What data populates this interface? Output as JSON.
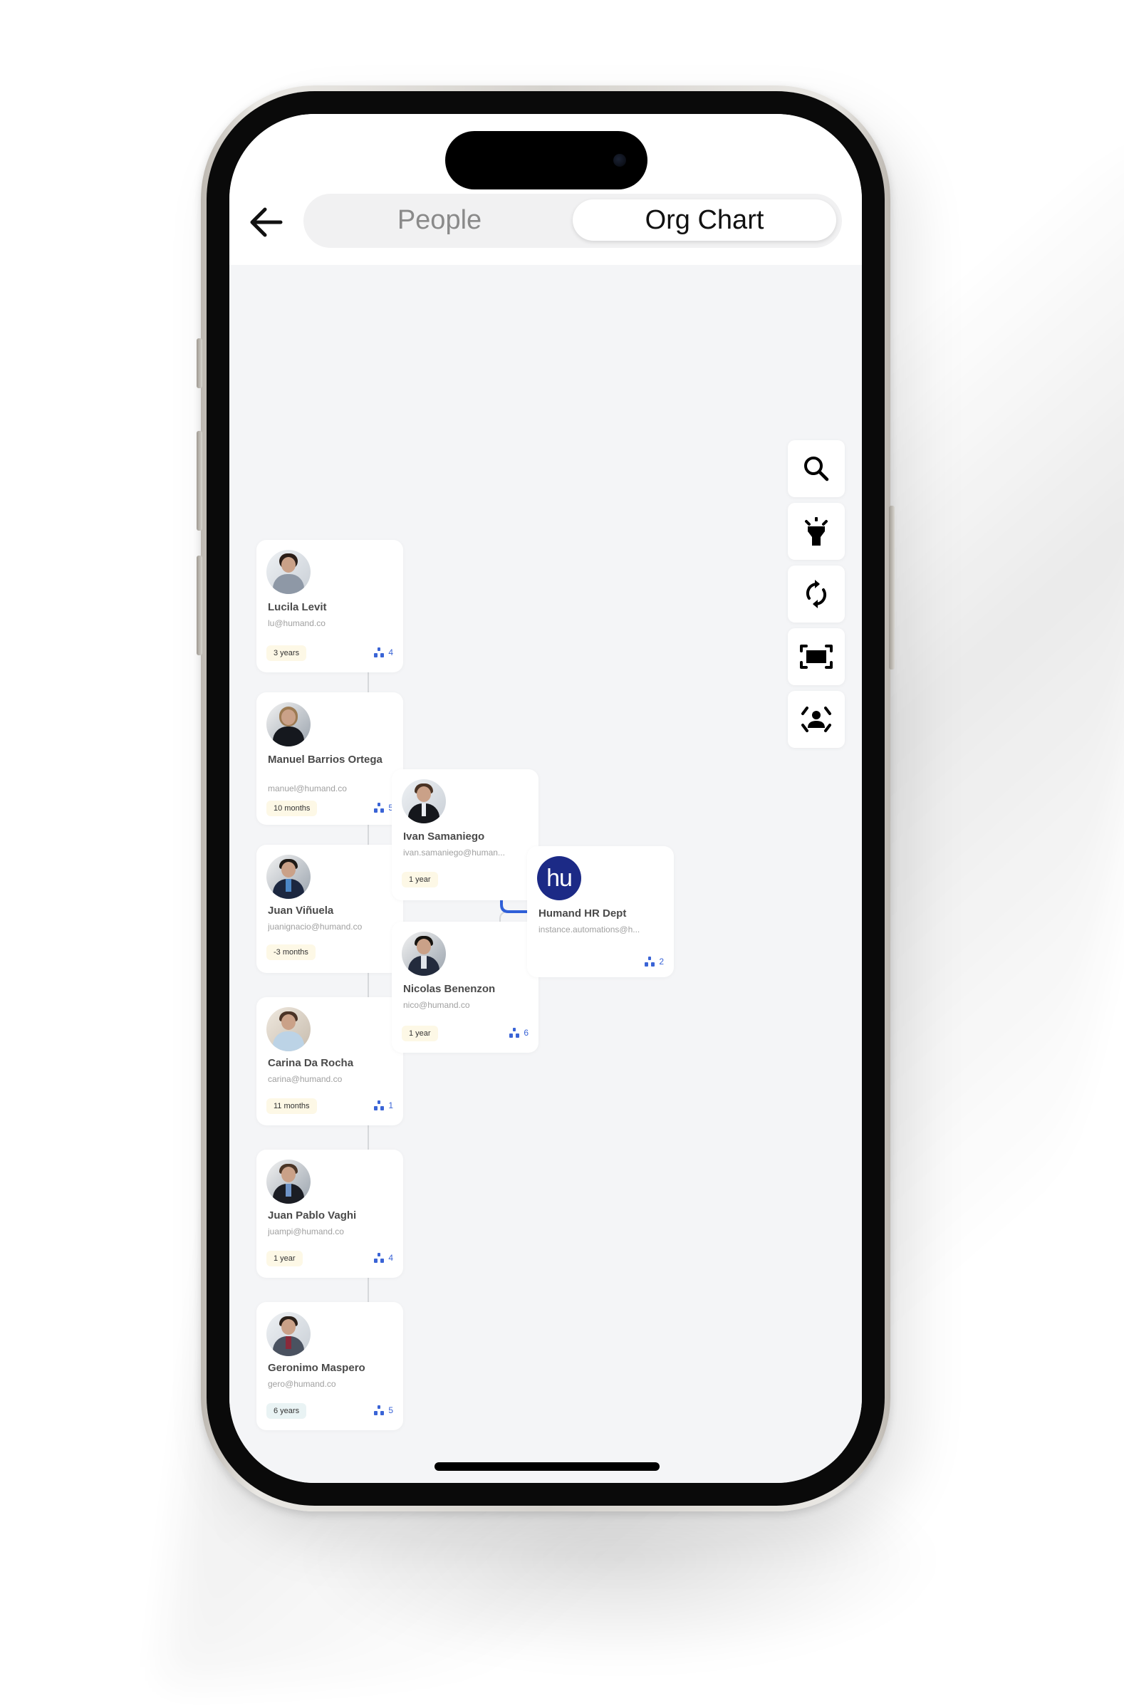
{
  "header": {
    "back_label": "Back",
    "tabs": [
      {
        "label": "People",
        "active": false
      },
      {
        "label": "Org Chart",
        "active": true
      }
    ]
  },
  "toolbar": {
    "buttons": [
      {
        "icon": "search-icon",
        "label": "Search"
      },
      {
        "icon": "flashlight-icon",
        "label": "Highlight"
      },
      {
        "icon": "refresh-icon",
        "label": "Reset"
      },
      {
        "icon": "fit-screen-icon",
        "label": "Fit to screen"
      },
      {
        "icon": "center-user-icon",
        "label": "Center on me"
      }
    ]
  },
  "org_chart": {
    "root": {
      "name": "Humand HR Dept",
      "email": "instance.automations@h...",
      "logo_text": "hu",
      "reports": "2",
      "logo_color": "#1c2a86"
    },
    "managers": [
      {
        "name": "Ivan Samaniego",
        "email": "ivan.samaniego@human...",
        "tenure": "1 year",
        "reports": null
      },
      {
        "name": "Nicolas Benenzon",
        "email": "nico@humand.co",
        "tenure": "1 year",
        "reports": "6"
      }
    ],
    "team": [
      {
        "name": "Lucila Levit",
        "email": "lu@humand.co",
        "tenure": "3 years",
        "reports": "4"
      },
      {
        "name": "Manuel Barrios Ortega",
        "email": "manuel@humand.co",
        "tenure": "10 months",
        "reports": "5"
      },
      {
        "name": "Juan Viñuela",
        "email": "juanignacio@humand.co",
        "tenure": "-3 months",
        "reports": null
      },
      {
        "name": "Carina Da Rocha",
        "email": "carina@humand.co",
        "tenure": "11 months",
        "reports": "1"
      },
      {
        "name": "Juan Pablo Vaghi",
        "email": "juampi@humand.co",
        "tenure": "1 year",
        "reports": "4"
      },
      {
        "name": "Geronimo Maspero",
        "email": "gero@humand.co",
        "tenure": "6 years",
        "reports": "5"
      }
    ]
  },
  "colors": {
    "accent": "#3a64d6",
    "highlight_line": "#2f5fd8",
    "connector": "#d6d8db",
    "tenure_badge": "#fdf8e6",
    "tenure_badge_alt": "#e9f3f4",
    "canvas_bg": "#f4f5f7"
  }
}
